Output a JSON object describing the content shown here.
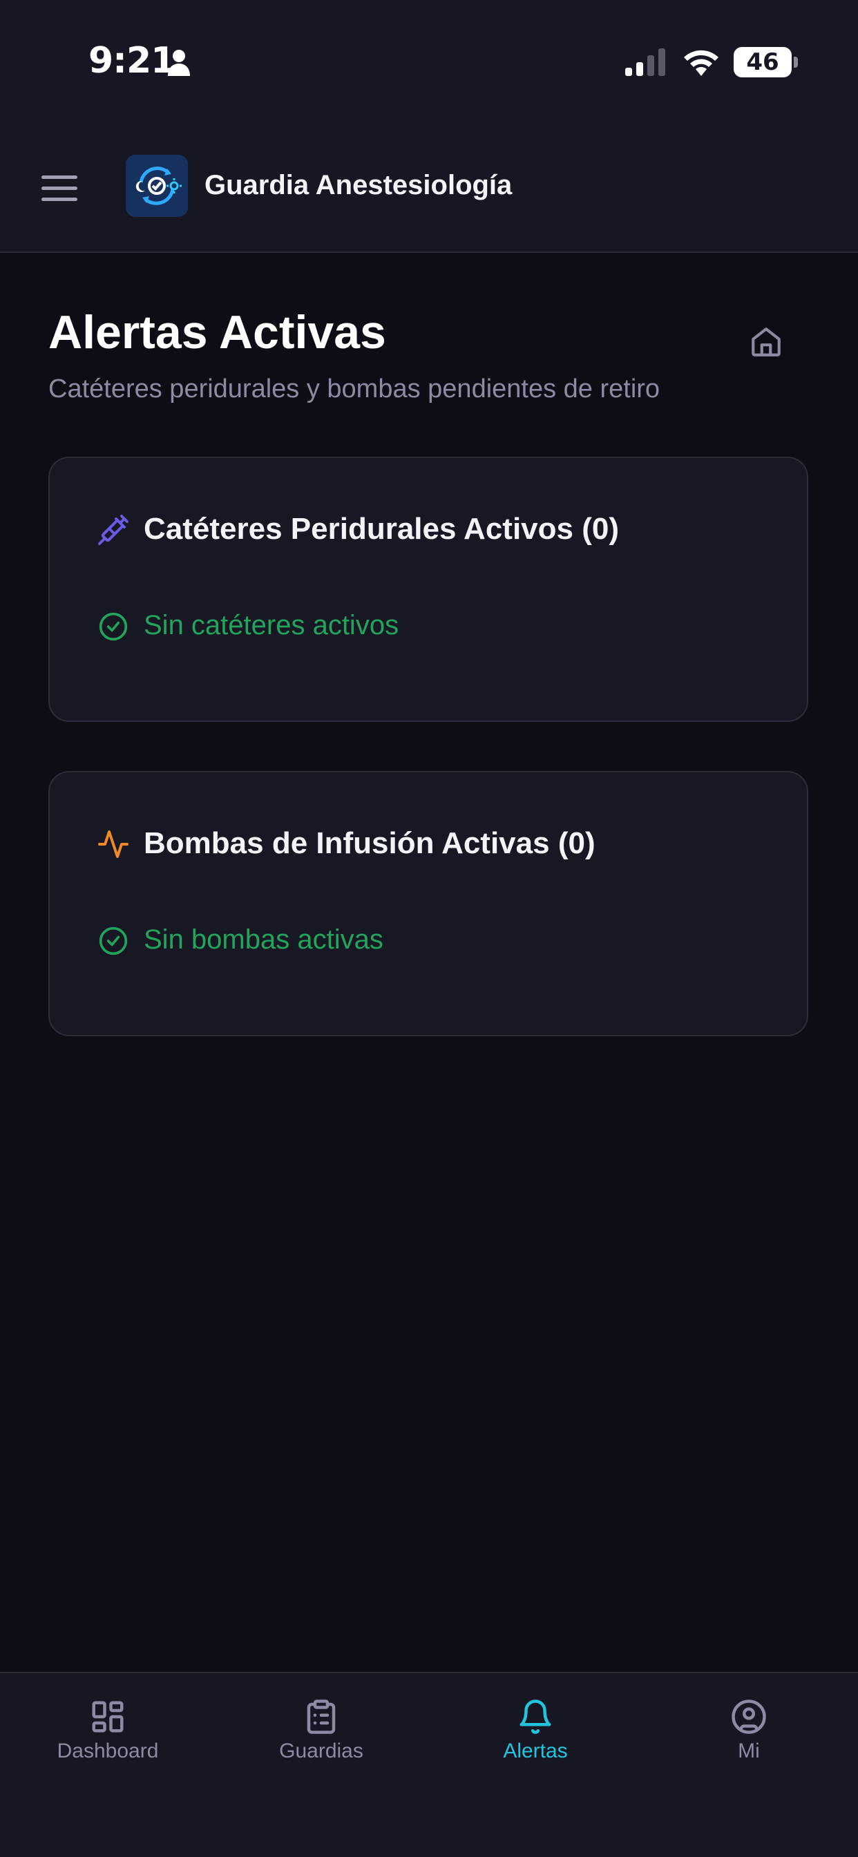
{
  "status_bar": {
    "time": "9:21",
    "battery": "46",
    "battery_level": 0.46
  },
  "header": {
    "app_title": "Guardia Anestesiología"
  },
  "page": {
    "title": "Alertas Activas",
    "subtitle": "Catéteres peridurales y bombas pendientes de retiro"
  },
  "cards": [
    {
      "title": "Catéteres Peridurales Activos (0)",
      "status": "Sin catéteres activos",
      "icon": "syringe-icon",
      "icon_color": "#6b5ce7"
    },
    {
      "title": "Bombas de Infusión Activas (0)",
      "status": "Sin bombas activas",
      "icon": "activity-icon",
      "icon_color": "#f08a24"
    }
  ],
  "bottom_nav": {
    "items": [
      {
        "label": "Dashboard",
        "icon": "dashboard-icon",
        "active": false
      },
      {
        "label": "Guardias",
        "icon": "clipboard-icon",
        "active": false
      },
      {
        "label": "Alertas",
        "icon": "bell-icon",
        "active": true
      },
      {
        "label": "Mi",
        "icon": "user-circle-icon",
        "active": false
      }
    ]
  },
  "colors": {
    "background": "#0d0d16",
    "surface": "#171723",
    "accent": "#22c4de",
    "success": "#22a55a",
    "muted_text": "#8b8ba3"
  }
}
